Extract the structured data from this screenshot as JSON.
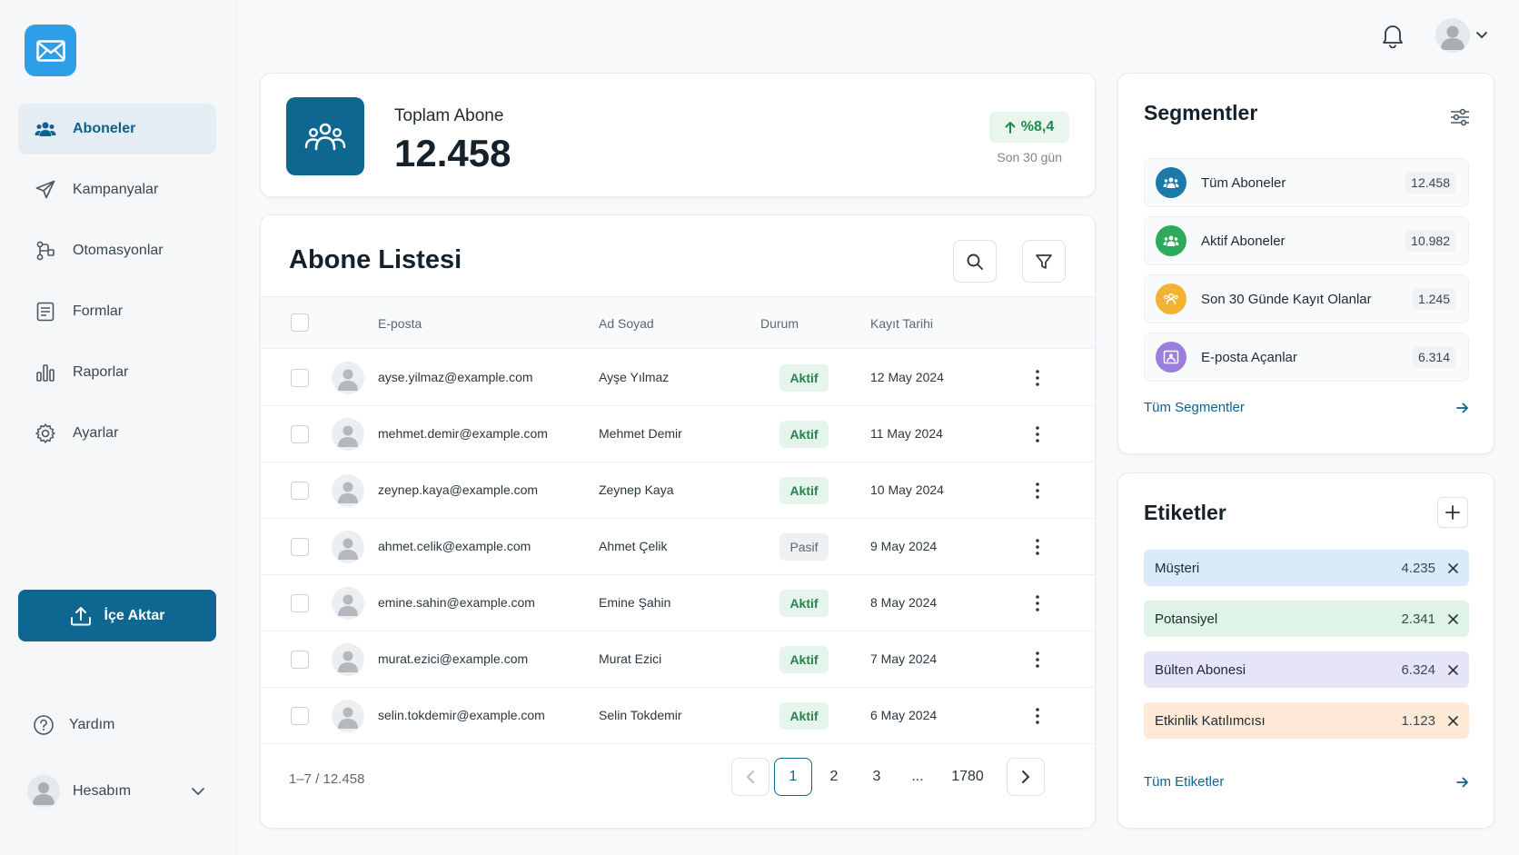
{
  "sidebar": {
    "items": [
      {
        "label": "Aboneler"
      },
      {
        "label": "Kampanyalar"
      },
      {
        "label": "Otomasyonlar"
      },
      {
        "label": "Formlar"
      },
      {
        "label": "Raporlar"
      },
      {
        "label": "Ayarlar"
      }
    ],
    "import_label": "İçe Aktar",
    "help_label": "Yardım",
    "account_label": "Hesabım"
  },
  "colors": {
    "primary": "#0e6791",
    "logo": "#2f9ee8",
    "success": "#27824e",
    "segment_all": "#1b7aa8",
    "segment_active": "#2eaa5a",
    "segment_recent": "#f2b233",
    "segment_openers": "#9b7fdc",
    "tag_customer": "#d9ebfa",
    "tag_potential": "#dff4e6",
    "tag_newsletter": "#e6e4f7",
    "tag_event": "#fde9d6"
  },
  "stat": {
    "label": "Toplam Abone",
    "value": "12.458",
    "change": "%8,4",
    "period": "Son 30 gün"
  },
  "list": {
    "title": "Abone Listesi",
    "columns": {
      "email": "E-posta",
      "name": "Ad Soyad",
      "status": "Durum",
      "date": "Kayıt Tarihi"
    },
    "rows": [
      {
        "email": "ayse.yilmaz@example.com",
        "name": "Ayşe Yılmaz",
        "status": "Aktif",
        "date": "12 May 2024"
      },
      {
        "email": "mehmet.demir@example.com",
        "name": "Mehmet Demir",
        "status": "Aktif",
        "date": "11 May 2024"
      },
      {
        "email": "zeynep.kaya@example.com",
        "name": "Zeynep Kaya",
        "status": "Aktif",
        "date": "10 May 2024"
      },
      {
        "email": "ahmet.celik@example.com",
        "name": "Ahmet Çelik",
        "status": "Pasif",
        "date": "9 May 2024"
      },
      {
        "email": "emine.sahin@example.com",
        "name": "Emine Şahin",
        "status": "Aktif",
        "date": "8 May 2024"
      },
      {
        "email": "murat.ezici@example.com",
        "name": "Murat Ezici",
        "status": "Aktif",
        "date": "7 May 2024"
      },
      {
        "email": "selin.tokdemir@example.com",
        "name": "Selin Tokdemir",
        "status": "Aktif",
        "date": "6 May 2024"
      }
    ],
    "range_text": "1–7 / 12.458",
    "pages": [
      "1",
      "2",
      "3",
      "...",
      "1780"
    ]
  },
  "segments": {
    "title": "Segmentler",
    "items": [
      {
        "name": "Tüm Aboneler",
        "count": "12.458"
      },
      {
        "name": "Aktif Aboneler",
        "count": "10.982"
      },
      {
        "name": "Son 30 Günde Kayıt Olanlar",
        "count": "1.245"
      },
      {
        "name": "E-posta Açanlar",
        "count": "6.314"
      }
    ],
    "link": "Tüm Segmentler"
  },
  "tags": {
    "title": "Etiketler",
    "items": [
      {
        "name": "Müşteri",
        "count": "4.235"
      },
      {
        "name": "Potansiyel",
        "count": "2.341"
      },
      {
        "name": "Bülten Abonesi",
        "count": "6.324"
      },
      {
        "name": "Etkinlik Katılımcısı",
        "count": "1.123"
      }
    ],
    "link": "Tüm Etiketler"
  }
}
